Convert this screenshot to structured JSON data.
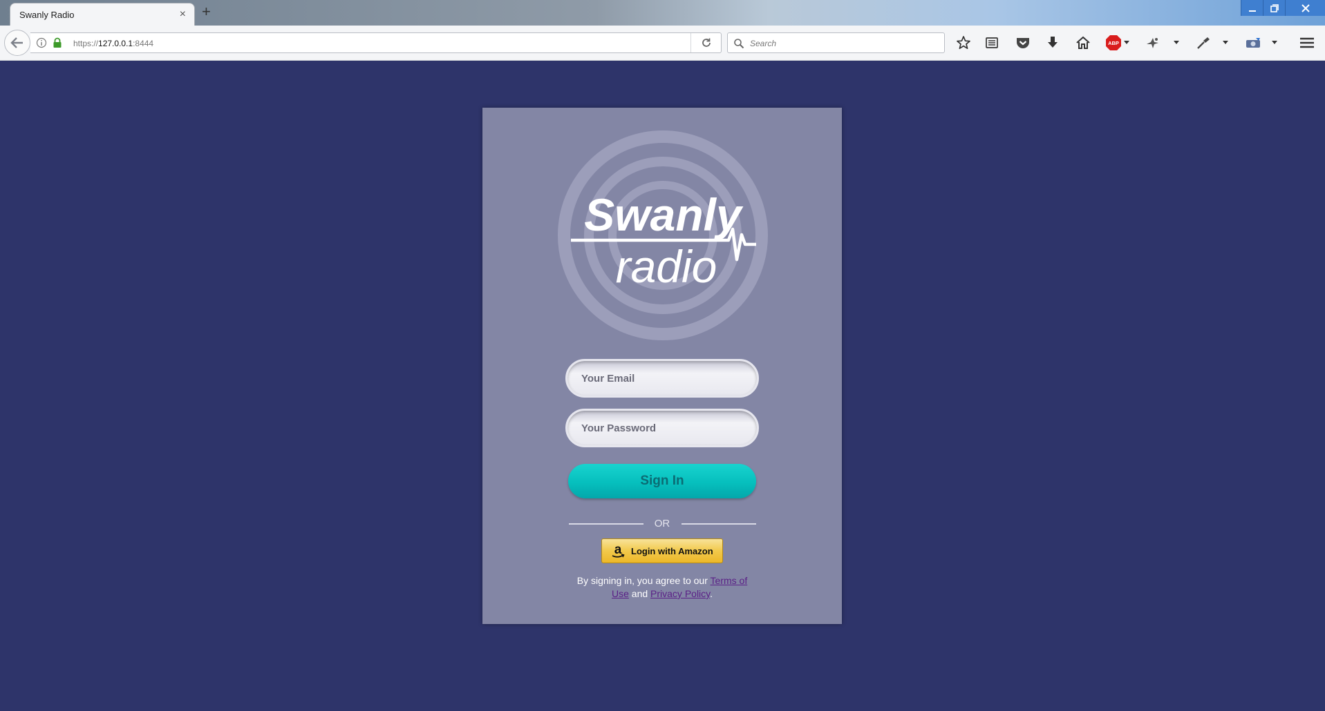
{
  "browser": {
    "tab_title": "Swanly Radio",
    "tab_close": "×",
    "new_tab": "+",
    "url_scheme": "https://",
    "url_host": "127.0.0.1",
    "url_port": ":8444",
    "search_placeholder": "Search",
    "window_controls": [
      "minimize",
      "restore",
      "close"
    ]
  },
  "toolbar_icons": [
    "star-icon",
    "reading-list-icon",
    "pocket-icon",
    "download-icon",
    "home-icon",
    "adblock-plus-icon",
    "extension-icon",
    "eyedropper-icon",
    "camera-icon",
    "menu-icon"
  ],
  "logo": {
    "line1": "Swanly",
    "line2": "radio"
  },
  "login": {
    "email_placeholder": "Your Email",
    "password_placeholder": "Your Password",
    "signin_label": "Sign In",
    "or_label": "OR",
    "amazon_label": "Login with Amazon",
    "terms_prefix": "By signing in, you agree to our ",
    "terms_link": "Terms of Use",
    "terms_and": " and ",
    "privacy_link": "Privacy Policy",
    "terms_suffix": "."
  },
  "colors": {
    "page_background": "#2e346a",
    "card_background": "#8386a5",
    "signin_button": "#06bfbd",
    "amazon_button": "#f2c94b",
    "link": "#5a1f86"
  }
}
